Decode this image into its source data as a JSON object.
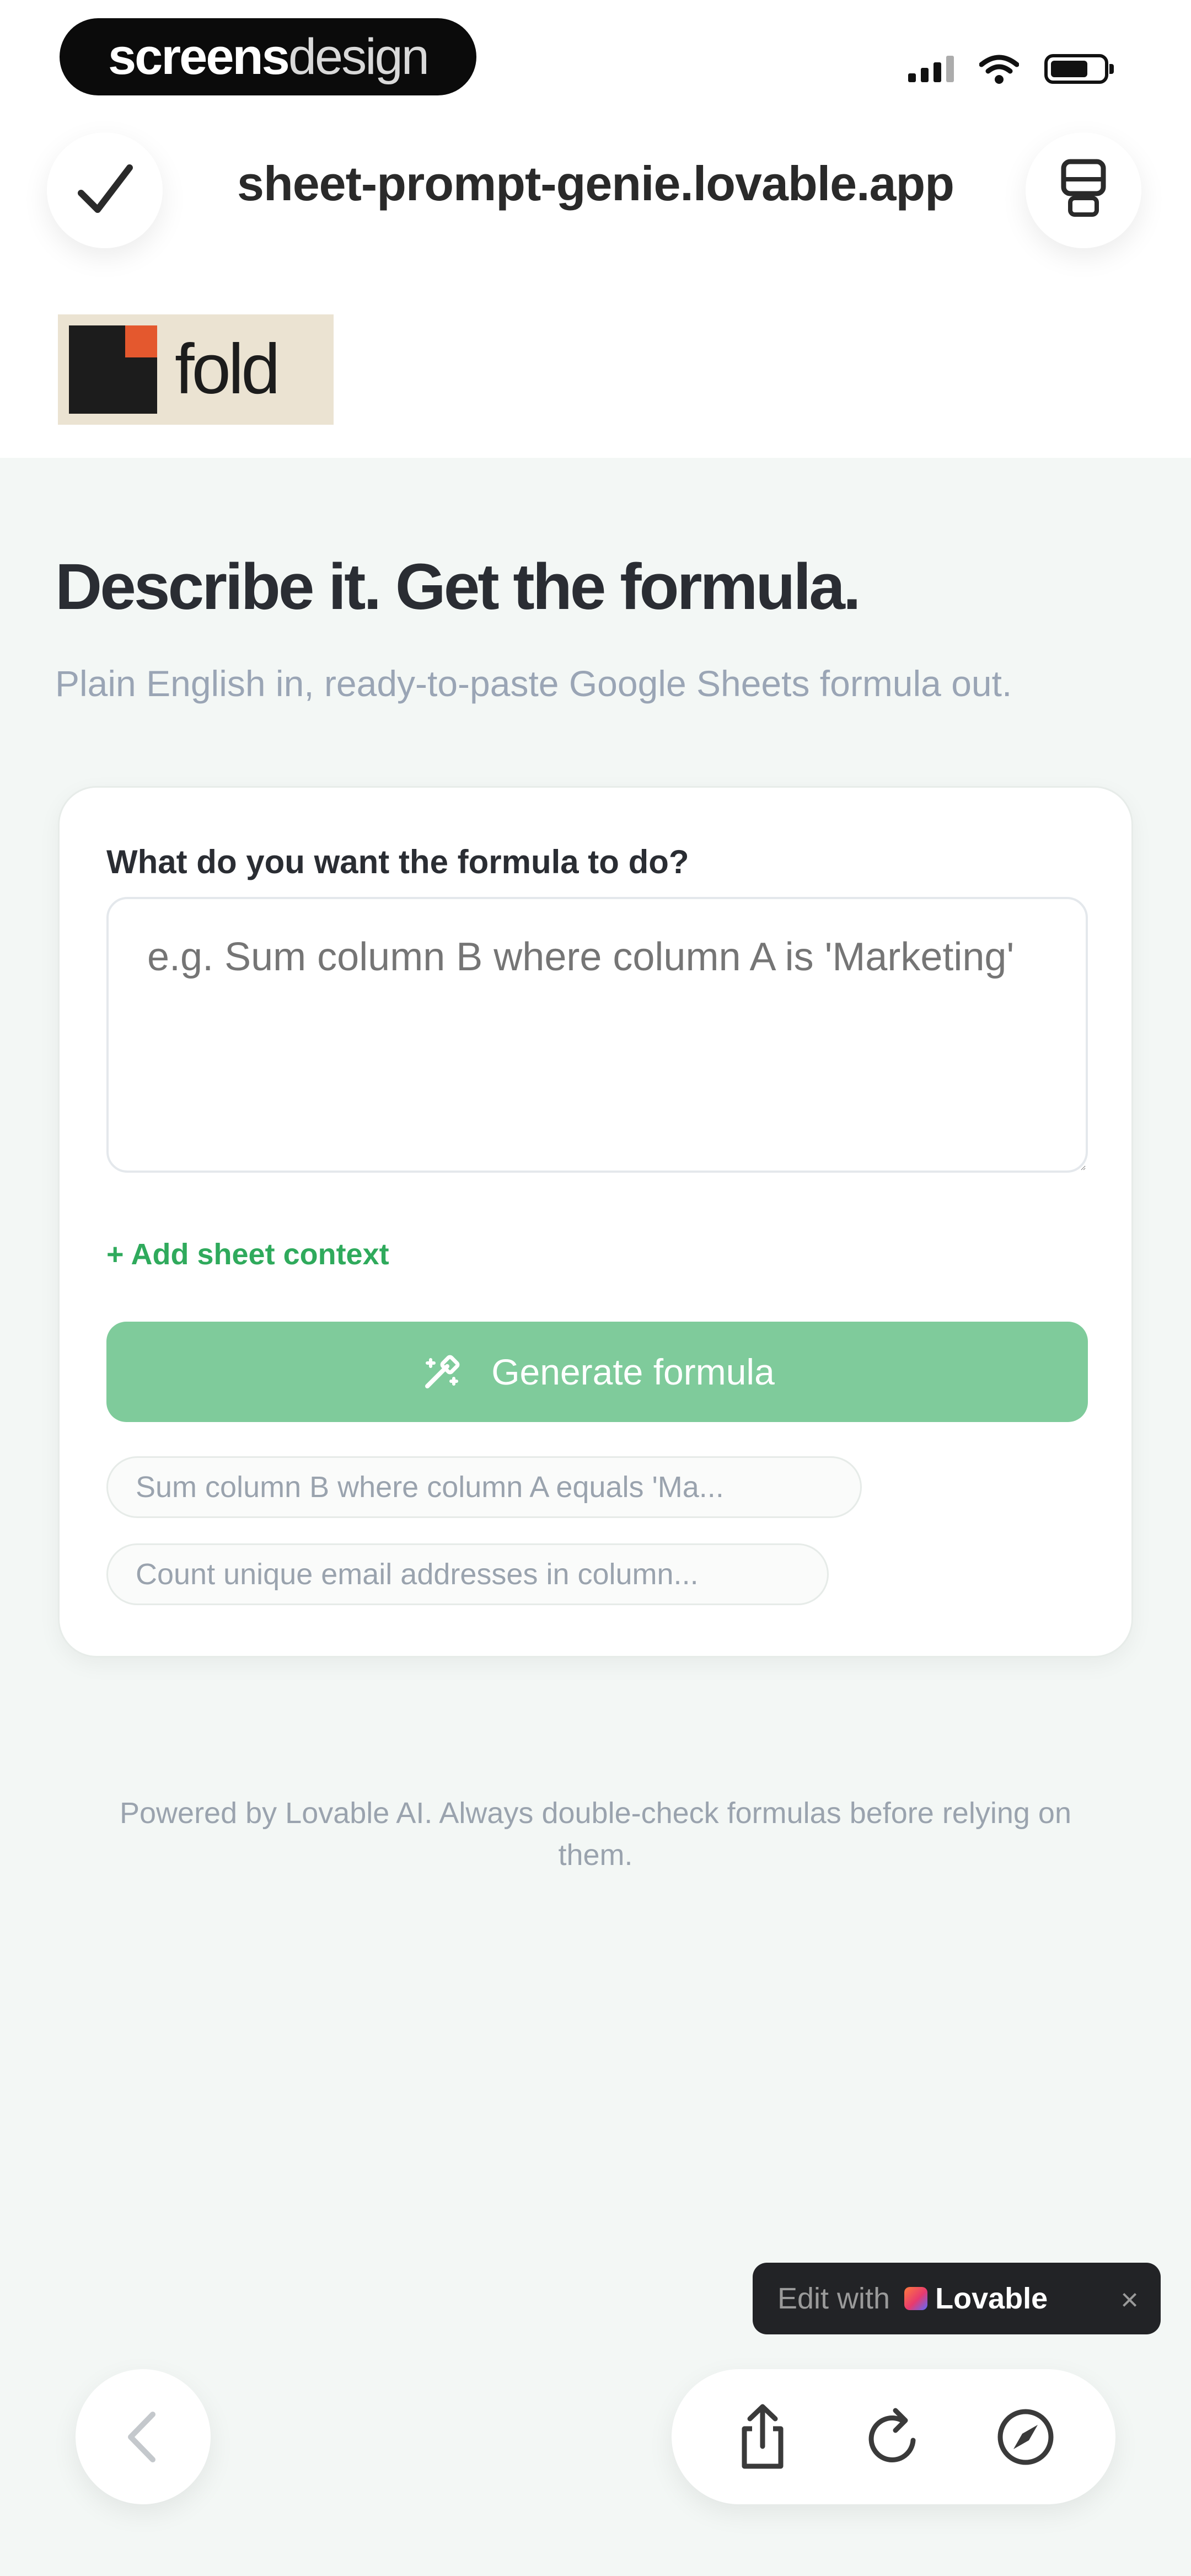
{
  "status_bar": {
    "brand_bold": "screens",
    "brand_light": "design"
  },
  "browser": {
    "url": "sheet-prompt-genie.lovable.app",
    "left_icon": "check-icon",
    "right_icon": "tab-stack-icon"
  },
  "logo": {
    "word": "fold"
  },
  "hero": {
    "title": "Describe it. Get the formula.",
    "subtitle": "Plain English in, ready-to-paste Google Sheets formula out."
  },
  "form": {
    "question_label": "What do you want the formula to do?",
    "input_value": "",
    "input_placeholder": "e.g. Sum column B where column A is 'Marketing'",
    "add_context_label": "+ Add sheet context",
    "generate_label": "Generate formula",
    "generate_icon": "sparkle-wand-icon",
    "examples": [
      "Sum column B where column A equals 'Ma...",
      "Count unique email addresses in column..."
    ]
  },
  "footer": {
    "note": "Powered by Lovable AI. Always double-check formulas before relying on them."
  },
  "badge": {
    "edit_with": "Edit with",
    "brand": "Lovable",
    "close": "×"
  },
  "bottom_nav": {
    "icons": [
      "back-icon",
      "share-icon",
      "reload-icon",
      "compass-icon"
    ]
  },
  "colors": {
    "accent_green": "#7fcb9b",
    "link_green": "#2faa5c",
    "page_bg": "#f3f7f5",
    "badge_bg": "#222326"
  }
}
